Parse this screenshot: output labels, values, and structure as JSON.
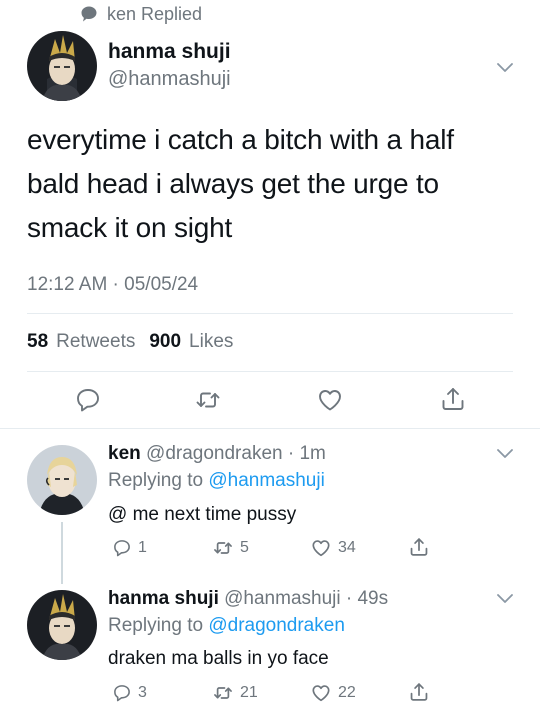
{
  "context": {
    "replied_label": "ken Replied"
  },
  "main_tweet": {
    "name": "hanma shuji",
    "handle": "@hanmashuji",
    "text": "everytime i catch a bitch with a half bald head i always get the urge to smack it on sight",
    "timestamp": "12:12 AM · 05/05/24",
    "retweets_count": "58",
    "retweets_label": "Retweets",
    "likes_count": "900",
    "likes_label": "Likes"
  },
  "replies": [
    {
      "name": "ken",
      "handle_time": "@dragondraken · 1m",
      "replying_prefix": "Replying to",
      "replying_to": "@hanmashuji",
      "text": "@ me next time pussy",
      "reply_count": "1",
      "retweet_count": "5",
      "like_count": "34"
    },
    {
      "name": "hanma shuji",
      "handle_time": "@hanmashuji · 49s",
      "replying_prefix": "Replying to",
      "replying_to": "@dragondraken",
      "text": "draken ma balls in yo face",
      "reply_count": "3",
      "retweet_count": "21",
      "like_count": "22"
    }
  ],
  "icons": {
    "reply": "reply-icon",
    "retweet": "retweet-icon",
    "like": "heart-icon",
    "share": "share-icon",
    "chevron": "chevron-down-icon"
  },
  "colors": {
    "accent": "#1d9bf0",
    "secondary_text": "#6e767d",
    "divider": "#e6ecf0"
  }
}
